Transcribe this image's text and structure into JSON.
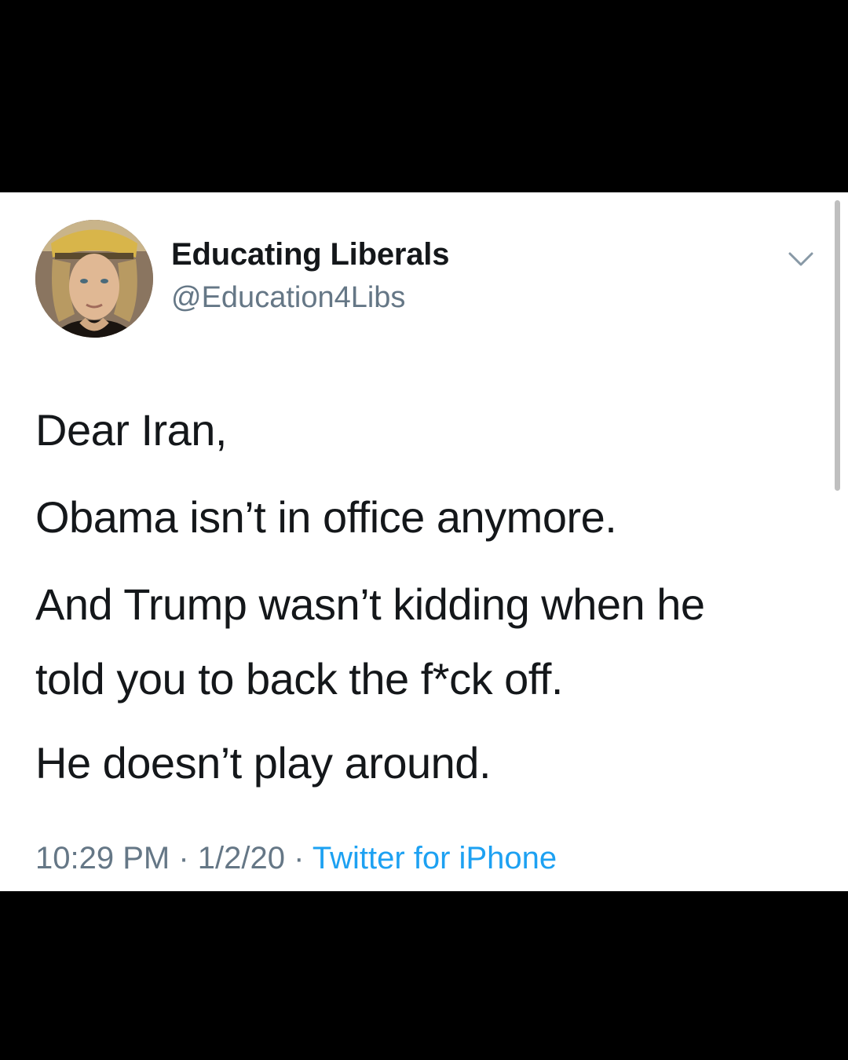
{
  "author": {
    "display_name": "Educating Liberals",
    "handle": "@Education4Libs",
    "avatar_icon": "profile-photo"
  },
  "menu": {
    "icon": "chevron-down-icon"
  },
  "tweet": {
    "lines": [
      "Dear Iran,",
      "Obama isn’t in office anymore.",
      "And Trump wasn’t kidding when he",
      "told you to back the f*ck off.",
      "He doesn’t play around."
    ]
  },
  "meta": {
    "time": "10:29 PM",
    "separator": "·",
    "date": "1/2/20",
    "source": "Twitter for iPhone"
  },
  "colors": {
    "background": "#000000",
    "card": "#ffffff",
    "text": "#14171a",
    "secondary": "#657786",
    "link": "#1da1f2"
  }
}
